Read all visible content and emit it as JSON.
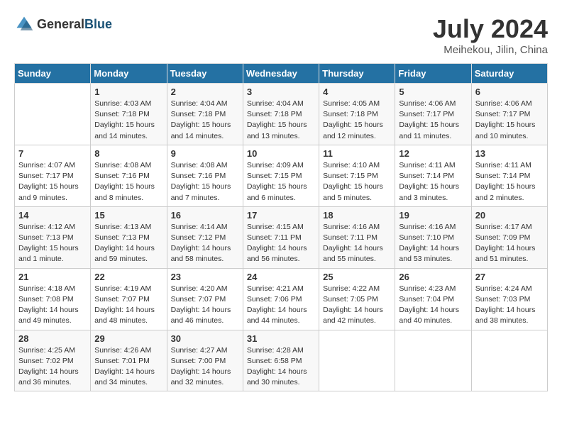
{
  "header": {
    "logo_general": "General",
    "logo_blue": "Blue",
    "title": "July 2024",
    "location": "Meihekou, Jilin, China"
  },
  "days_of_week": [
    "Sunday",
    "Monday",
    "Tuesday",
    "Wednesday",
    "Thursday",
    "Friday",
    "Saturday"
  ],
  "weeks": [
    [
      null,
      {
        "day": 1,
        "sunrise": "4:03 AM",
        "sunset": "7:18 PM",
        "daylight": "15 hours and 14 minutes."
      },
      {
        "day": 2,
        "sunrise": "4:04 AM",
        "sunset": "7:18 PM",
        "daylight": "15 hours and 14 minutes."
      },
      {
        "day": 3,
        "sunrise": "4:04 AM",
        "sunset": "7:18 PM",
        "daylight": "15 hours and 13 minutes."
      },
      {
        "day": 4,
        "sunrise": "4:05 AM",
        "sunset": "7:18 PM",
        "daylight": "15 hours and 12 minutes."
      },
      {
        "day": 5,
        "sunrise": "4:06 AM",
        "sunset": "7:17 PM",
        "daylight": "15 hours and 11 minutes."
      },
      {
        "day": 6,
        "sunrise": "4:06 AM",
        "sunset": "7:17 PM",
        "daylight": "15 hours and 10 minutes."
      }
    ],
    [
      {
        "day": 7,
        "sunrise": "4:07 AM",
        "sunset": "7:17 PM",
        "daylight": "15 hours and 9 minutes."
      },
      {
        "day": 8,
        "sunrise": "4:08 AM",
        "sunset": "7:16 PM",
        "daylight": "15 hours and 8 minutes."
      },
      {
        "day": 9,
        "sunrise": "4:08 AM",
        "sunset": "7:16 PM",
        "daylight": "15 hours and 7 minutes."
      },
      {
        "day": 10,
        "sunrise": "4:09 AM",
        "sunset": "7:15 PM",
        "daylight": "15 hours and 6 minutes."
      },
      {
        "day": 11,
        "sunrise": "4:10 AM",
        "sunset": "7:15 PM",
        "daylight": "15 hours and 5 minutes."
      },
      {
        "day": 12,
        "sunrise": "4:11 AM",
        "sunset": "7:14 PM",
        "daylight": "15 hours and 3 minutes."
      },
      {
        "day": 13,
        "sunrise": "4:11 AM",
        "sunset": "7:14 PM",
        "daylight": "15 hours and 2 minutes."
      }
    ],
    [
      {
        "day": 14,
        "sunrise": "4:12 AM",
        "sunset": "7:13 PM",
        "daylight": "15 hours and 1 minute."
      },
      {
        "day": 15,
        "sunrise": "4:13 AM",
        "sunset": "7:13 PM",
        "daylight": "14 hours and 59 minutes."
      },
      {
        "day": 16,
        "sunrise": "4:14 AM",
        "sunset": "7:12 PM",
        "daylight": "14 hours and 58 minutes."
      },
      {
        "day": 17,
        "sunrise": "4:15 AM",
        "sunset": "7:11 PM",
        "daylight": "14 hours and 56 minutes."
      },
      {
        "day": 18,
        "sunrise": "4:16 AM",
        "sunset": "7:11 PM",
        "daylight": "14 hours and 55 minutes."
      },
      {
        "day": 19,
        "sunrise": "4:16 AM",
        "sunset": "7:10 PM",
        "daylight": "14 hours and 53 minutes."
      },
      {
        "day": 20,
        "sunrise": "4:17 AM",
        "sunset": "7:09 PM",
        "daylight": "14 hours and 51 minutes."
      }
    ],
    [
      {
        "day": 21,
        "sunrise": "4:18 AM",
        "sunset": "7:08 PM",
        "daylight": "14 hours and 49 minutes."
      },
      {
        "day": 22,
        "sunrise": "4:19 AM",
        "sunset": "7:07 PM",
        "daylight": "14 hours and 48 minutes."
      },
      {
        "day": 23,
        "sunrise": "4:20 AM",
        "sunset": "7:07 PM",
        "daylight": "14 hours and 46 minutes."
      },
      {
        "day": 24,
        "sunrise": "4:21 AM",
        "sunset": "7:06 PM",
        "daylight": "14 hours and 44 minutes."
      },
      {
        "day": 25,
        "sunrise": "4:22 AM",
        "sunset": "7:05 PM",
        "daylight": "14 hours and 42 minutes."
      },
      {
        "day": 26,
        "sunrise": "4:23 AM",
        "sunset": "7:04 PM",
        "daylight": "14 hours and 40 minutes."
      },
      {
        "day": 27,
        "sunrise": "4:24 AM",
        "sunset": "7:03 PM",
        "daylight": "14 hours and 38 minutes."
      }
    ],
    [
      {
        "day": 28,
        "sunrise": "4:25 AM",
        "sunset": "7:02 PM",
        "daylight": "14 hours and 36 minutes."
      },
      {
        "day": 29,
        "sunrise": "4:26 AM",
        "sunset": "7:01 PM",
        "daylight": "14 hours and 34 minutes."
      },
      {
        "day": 30,
        "sunrise": "4:27 AM",
        "sunset": "7:00 PM",
        "daylight": "14 hours and 32 minutes."
      },
      {
        "day": 31,
        "sunrise": "4:28 AM",
        "sunset": "6:58 PM",
        "daylight": "14 hours and 30 minutes."
      },
      null,
      null,
      null
    ]
  ]
}
